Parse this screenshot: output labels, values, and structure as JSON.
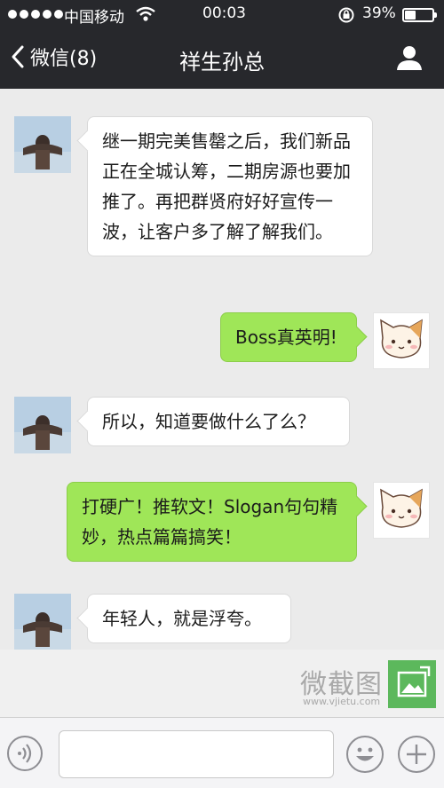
{
  "status_bar": {
    "carrier": "中国移动",
    "time": "00:03",
    "battery_percent": "39%",
    "battery_level": 0.39,
    "icons": [
      "signal-dots-icon",
      "wifi-icon",
      "orientation-lock-icon",
      "battery-icon"
    ]
  },
  "nav": {
    "back_label": "微信(8)",
    "title": "祥生孙总",
    "icons": [
      "back-chevron-icon",
      "profile-icon"
    ]
  },
  "messages": [
    {
      "side": "left",
      "sender": "boss",
      "text": "继一期完美售罄之后，我们新品正在全城认筹，二期房源也要加推了。再把群贤府好好宣传一波，让客户多了解了解我们。"
    },
    {
      "side": "right",
      "sender": "me",
      "text": "Boss真英明!"
    },
    {
      "side": "left",
      "sender": "boss",
      "text": "所以，知道要做什么了么？"
    },
    {
      "side": "right",
      "sender": "me",
      "text": "打硬广！推软文！Slogan句句精妙，热点篇篇搞笑！"
    },
    {
      "side": "left",
      "sender": "boss",
      "text": "年轻人，就是浮夸。"
    }
  ],
  "watermark": {
    "title": "微截图",
    "url": "www.vjietu.com"
  },
  "input_bar": {
    "message_value": "",
    "icons": [
      "voice-icon",
      "emoji-icon",
      "add-icon"
    ]
  },
  "colors": {
    "nav_background": "#27282c",
    "chat_background": "#ebebeb",
    "outgoing_bubble": "#9fe658",
    "incoming_bubble": "#ffffff",
    "watermark_logo": "#5cb85c"
  }
}
